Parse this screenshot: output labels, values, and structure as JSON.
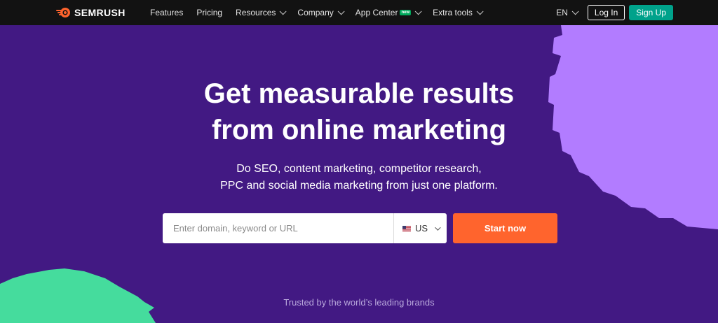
{
  "nav": {
    "logo_text": "SEMRUSH",
    "items": [
      {
        "label": "Features",
        "has_dropdown": false
      },
      {
        "label": "Pricing",
        "has_dropdown": false
      },
      {
        "label": "Resources",
        "has_dropdown": true
      },
      {
        "label": "Company",
        "has_dropdown": true
      },
      {
        "label": "App Center",
        "has_dropdown": true,
        "badge": "new"
      },
      {
        "label": "Extra tools",
        "has_dropdown": true
      }
    ],
    "language": "EN",
    "login_label": "Log In",
    "signup_label": "Sign Up"
  },
  "hero": {
    "title_line1": "Get measurable results",
    "title_line2": "from online marketing",
    "subtitle_line1": "Do SEO, content marketing, competitor research,",
    "subtitle_line2": "PPC and social media marketing from just one platform."
  },
  "search": {
    "placeholder": "Enter domain, keyword or URL",
    "value": "",
    "country": "US",
    "submit_label": "Start now"
  },
  "footer": {
    "trusted_text": "Trusted by the world’s leading brands"
  },
  "colors": {
    "background": "#421983",
    "nav_background": "#121212",
    "accent_orange": "#ff642d",
    "signup_green": "#00a28b",
    "deco_purple": "#b27cff",
    "deco_green": "#45dc9d"
  },
  "icons": {
    "logo": "semrush-flame-icon",
    "dropdown": "chevron-down-icon",
    "flag": "us-flag-icon"
  }
}
